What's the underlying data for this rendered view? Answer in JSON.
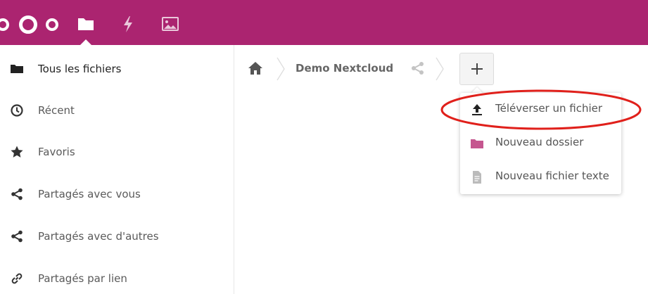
{
  "colors": {
    "header": "#ab2470",
    "folder_pink": "#c5568f",
    "highlight_red": "#e0201b",
    "icon_dark": "#222222",
    "icon_grey": "#bbbbbb"
  },
  "header": {
    "logo_icon": "nextcloud-logo-icon",
    "apps": [
      {
        "name": "files",
        "icon": "folder-icon",
        "active": true
      },
      {
        "name": "activity",
        "icon": "lightning-icon",
        "active": false
      },
      {
        "name": "gallery",
        "icon": "image-icon",
        "active": false
      }
    ]
  },
  "sidebar": {
    "items": [
      {
        "label": "Tous les fichiers",
        "icon": "folder-icon",
        "active": true
      },
      {
        "label": "Récent",
        "icon": "clock-icon",
        "active": false
      },
      {
        "label": "Favoris",
        "icon": "star-icon",
        "active": false
      },
      {
        "label": "Partagés avec vous",
        "icon": "share-icon",
        "active": false
      },
      {
        "label": "Partagés avec d'autres",
        "icon": "share-icon",
        "active": false
      },
      {
        "label": "Partagés par lien",
        "icon": "link-icon",
        "active": false
      }
    ]
  },
  "breadcrumb": {
    "home_icon": "home-icon",
    "folder": "Demo Nextcloud",
    "share_icon": "share-icon"
  },
  "new_button": {
    "icon": "plus-icon"
  },
  "new_menu": {
    "items": [
      {
        "label": "Téléverser un fichier",
        "icon": "upload-icon",
        "highlighted": true
      },
      {
        "label": "Nouveau dossier",
        "icon": "folder-icon",
        "highlighted": false
      },
      {
        "label": "Nouveau fichier texte",
        "icon": "text-file-icon",
        "highlighted": false
      }
    ]
  }
}
